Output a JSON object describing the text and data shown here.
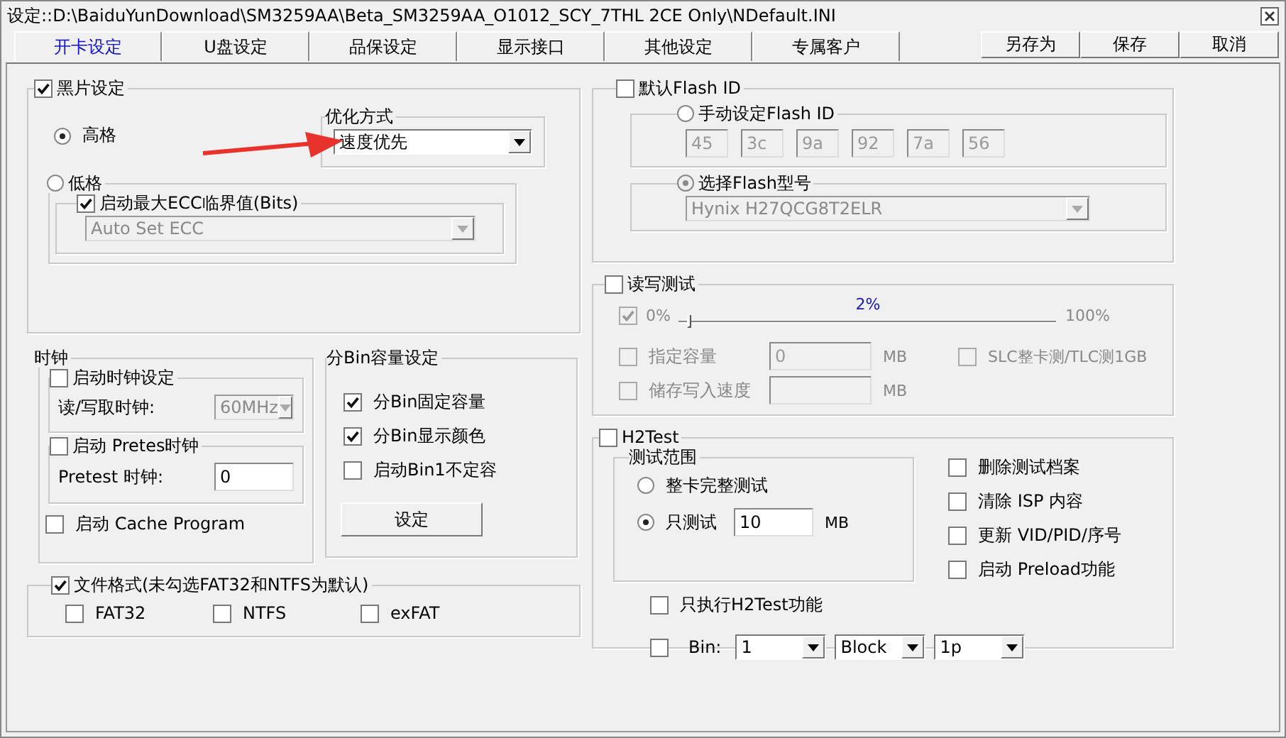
{
  "window": {
    "title": "设定::D:\\BaiduYunDownload\\SM3259AA\\Beta_SM3259AA_O1012_SCY_7THL 2CE Only\\NDefault.INI"
  },
  "tabs": [
    {
      "label": "开卡设定",
      "selected": true
    },
    {
      "label": "U盘设定",
      "selected": false
    },
    {
      "label": "品保设定",
      "selected": false
    },
    {
      "label": "显示接口",
      "selected": false
    },
    {
      "label": "其他设定",
      "selected": false
    },
    {
      "label": "专属客户",
      "selected": false
    }
  ],
  "actions": [
    "另存为",
    "保存",
    "取消"
  ],
  "black_chip": {
    "label": "黑片设定",
    "checked": true,
    "high": {
      "label": "高格",
      "selected": true
    },
    "optimize": {
      "title": "优化方式",
      "value": "速度优先"
    },
    "low": {
      "label": "低格",
      "selected": false
    },
    "ecc": {
      "label": "启动最大ECC临界值(Bits)",
      "checked": true,
      "value": "Auto Set ECC",
      "disabled": true
    }
  },
  "clock": {
    "title": "时钟",
    "clock_setting": {
      "label": "启动时钟设定",
      "checked": false,
      "field_label": "读/写取时钟:",
      "value": "60MHz",
      "disabled": true
    },
    "pretest": {
      "label": "启动 Pretes时钟",
      "checked": false,
      "field_label": "Pretest 时钟:",
      "value": "0"
    },
    "cache": {
      "label": "启动 Cache Program",
      "checked": false
    }
  },
  "bin": {
    "title": "分Bin容量设定",
    "options": [
      {
        "label": "分Bin固定容量",
        "checked": true
      },
      {
        "label": "分Bin显示颜色",
        "checked": true
      },
      {
        "label": "启动Bin1不定容",
        "checked": false
      }
    ],
    "button": "设定"
  },
  "file_format": {
    "label": "文件格式(未勾选FAT32和NTFS为默认)",
    "checked": true,
    "options": [
      {
        "label": "FAT32",
        "checked": false
      },
      {
        "label": "NTFS",
        "checked": false
      },
      {
        "label": "exFAT",
        "checked": false
      }
    ]
  },
  "flash_id": {
    "label": "默认Flash ID",
    "checked": false,
    "manual": {
      "label": "手动设定Flash ID",
      "selected": false,
      "disabled": true,
      "bytes": [
        "45",
        "3c",
        "9a",
        "92",
        "7a",
        "56"
      ]
    },
    "model": {
      "label": "选择Flash型号",
      "selected": true,
      "disabled": true,
      "value": "Hynix H27QCG8T2ELR"
    }
  },
  "rw_test": {
    "label": "读写测试",
    "checked": false,
    "disabled": true,
    "slider": {
      "checked": true,
      "min": "0%",
      "reading": "2%",
      "max": "100%",
      "level": 0.02
    },
    "capacity": {
      "label": "指定容量",
      "checked": false,
      "value": "0",
      "unit": "MB"
    },
    "slc": {
      "label": "SLC整卡测/TLC测1GB",
      "checked": false
    },
    "speed": {
      "label": "储存写入速度",
      "checked": false,
      "unit": "MB"
    }
  },
  "h2test": {
    "label": "H2Test",
    "checked": false,
    "range": {
      "title": "测试范围",
      "options": [
        {
          "label": "整卡完整测试",
          "selected": false
        },
        {
          "label": "只测试",
          "selected": true,
          "value": "10",
          "unit": "MB"
        }
      ]
    },
    "options": [
      {
        "label": "删除测试档案",
        "checked": false
      },
      {
        "label": "清除 ISP 内容",
        "checked": false
      },
      {
        "label": "更新 VID/PID/序号",
        "checked": false
      },
      {
        "label": "启动 Preload功能",
        "checked": false
      }
    ],
    "h2_only": {
      "label": "只执行H2Test功能",
      "checked": false
    },
    "bin_row": {
      "checked": false,
      "label": "Bin:",
      "selects": [
        "1",
        "Block",
        "1p"
      ]
    }
  }
}
